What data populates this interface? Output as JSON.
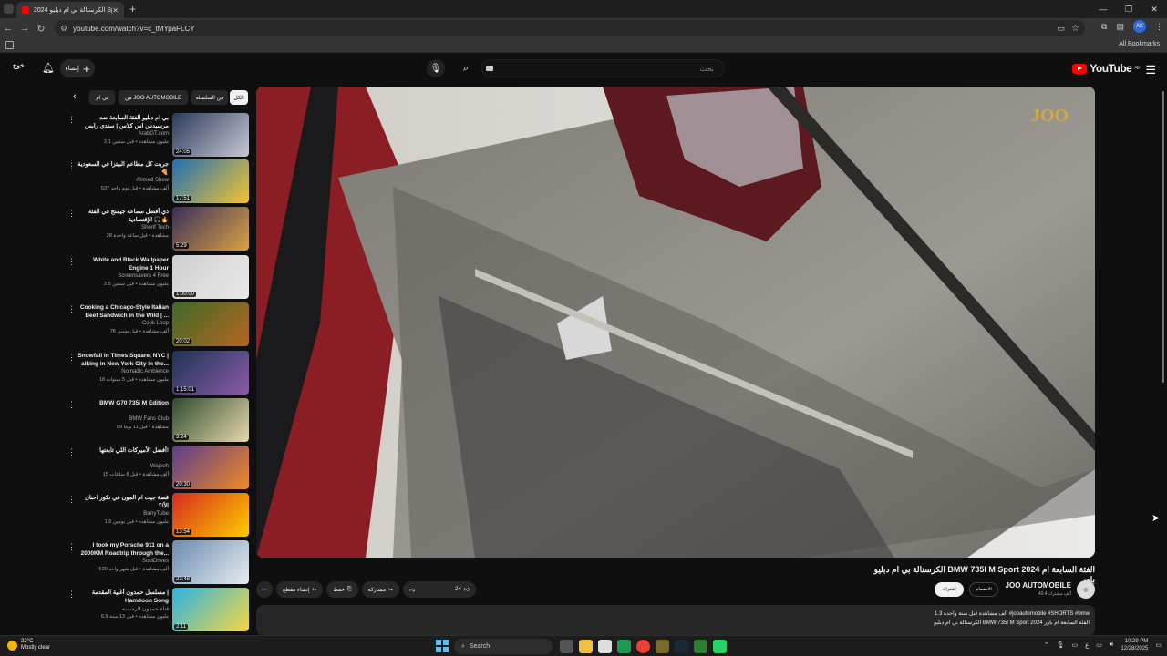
{
  "browser": {
    "tab_title": "الكرستالة بي ام دبليو 2024 Sport",
    "url": "youtube.com/watch?v=c_tMYpaFLCY",
    "all_bookmarks": "All Bookmarks",
    "profile_initials": "AK"
  },
  "header": {
    "logo": "YouTube",
    "logo_country": "AE",
    "search_placeholder": "بحث",
    "create_label": "إنشاء",
    "profile_label": "خوخ"
  },
  "chips": [
    {
      "label": "الكل",
      "active": true
    },
    {
      "label": "من السلسلة",
      "active": false
    },
    {
      "label": "من JOO AUTOMOBILE",
      "active": false
    },
    {
      "label": "بي ام",
      "active": false
    }
  ],
  "video": {
    "title": "الكرستالة بي ام دبليو BMW 735I M Sport 2024 الفئة السابعة ام باور",
    "like_count": "24",
    "share_label": "مشاركة",
    "save_label": "حفظ",
    "clip_label": "إنشاء مقطع",
    "channel": "JOO AUTOMOBILE",
    "subscribers": "40.4 ألف مشترك",
    "subscribe_label": "اشتراك",
    "join_label": "الانضمام",
    "views_line": "1.3 ألف مشاهدة  قبل سنة واحدة  #jooautomobile #SHORTS #bmw",
    "desc_line": "الكرستالة بي ام دبليو BMW 735I M Sport 2024 الفئة السابعة ام باور",
    "watermark": "JOO"
  },
  "recommendations": [
    {
      "title": "بي ام دبليو الفئة السابعة ضد مرسيدس اس كلاس | ستدي رابس رايس",
      "channel": "ArabGT.com",
      "meta": "2.1 مليون مشاهدة • قبل سنتين",
      "duration": "24:05",
      "color1": "#2b3a5c",
      "color2": "#c9c9d4"
    },
    {
      "title": "جربت كل مطاعم البيتزا في السعودية 🍕",
      "channel": "Ahmed Show",
      "meta": "537 ألف مشاهدة • قبل يوم واحد",
      "duration": "17:51",
      "color1": "#1f6fb3",
      "color2": "#f4c430"
    },
    {
      "title": "ذي أفضل سماعة جيمنج في الفئة الإقتصادية 🎧🔥",
      "channel": "Sherif Tech",
      "meta": "28 مشاهدة • قبل ساعة واحدة",
      "duration": "5:29",
      "color1": "#3a2d5c",
      "color2": "#d9a441"
    },
    {
      "title": "White and Black Wallpaper Engine 1 Hour",
      "channel": "Screensavers 4 Free",
      "meta": "2.5 مليون مشاهدة • قبل سنتين",
      "duration": "1:00:00",
      "color1": "#cfcfcf",
      "color2": "#e9e9e9"
    },
    {
      "title": "Cooking a Chicago-Style Italian Beef Sandwich in the Wild | ...",
      "channel": "Cook Loop",
      "meta": "78 ألف مشاهدة • قبل يومين",
      "duration": "20:02",
      "color1": "#3f6b2a",
      "color2": "#b5651d"
    },
    {
      "title": "Snowfall in Times Square, NYC | alking in New York City in the...",
      "channel": "Nomadic Ambience",
      "meta": "18 مليون مشاهدة • قبل 5 سنوات",
      "duration": "1:15:01",
      "color1": "#1d3357",
      "color2": "#8a5ca8"
    },
    {
      "title": "BMW G70 735i M Edition",
      "channel": "BMW Fans Club",
      "meta": "59 مشاهدة • قبل 11 يومًا",
      "duration": "3:24",
      "color1": "#2f4c2c",
      "color2": "#e7d8b0"
    },
    {
      "title": "أفضل الأميركات اللي تابعتها!",
      "channel": "Wajeeh",
      "meta": "15 ألف مشاهدة • قبل 8 ساعات",
      "duration": "20:30",
      "color1": "#5b3c8c",
      "color2": "#f08a24"
    },
    {
      "title": "قصة جيت ام المون في نكور احتان الأ!؟",
      "channel": "BarryTube",
      "meta": "1.5 مليون مشاهدة • قبل يومين",
      "duration": "13:54",
      "color1": "#d62a1e",
      "color2": "#ffcc00"
    },
    {
      "title": "I took my Porsche 911 on a 2000KM Roadtrip through the...",
      "channel": "SoulDrives",
      "meta": "620 ألف مشاهدة • قبل شهر واحد",
      "duration": "23:48",
      "color1": "#6a8bb0",
      "color2": "#e8ecef"
    },
    {
      "title": "مسلسل حمدون أغنية المقدمة | Hamdoon Song",
      "channel": "قناة حمدون الرسمية",
      "meta": "6.9 مليون مشاهدة • قبل 13 سنة",
      "duration": "2:11",
      "color1": "#2bb3e0",
      "color2": "#f6d743"
    }
  ],
  "taskbar": {
    "temp": "22°C",
    "weather": "Mostly clear",
    "search_label": "Search",
    "time": "10:29 PM",
    "date": "12/28/2025",
    "lang": "ع"
  }
}
